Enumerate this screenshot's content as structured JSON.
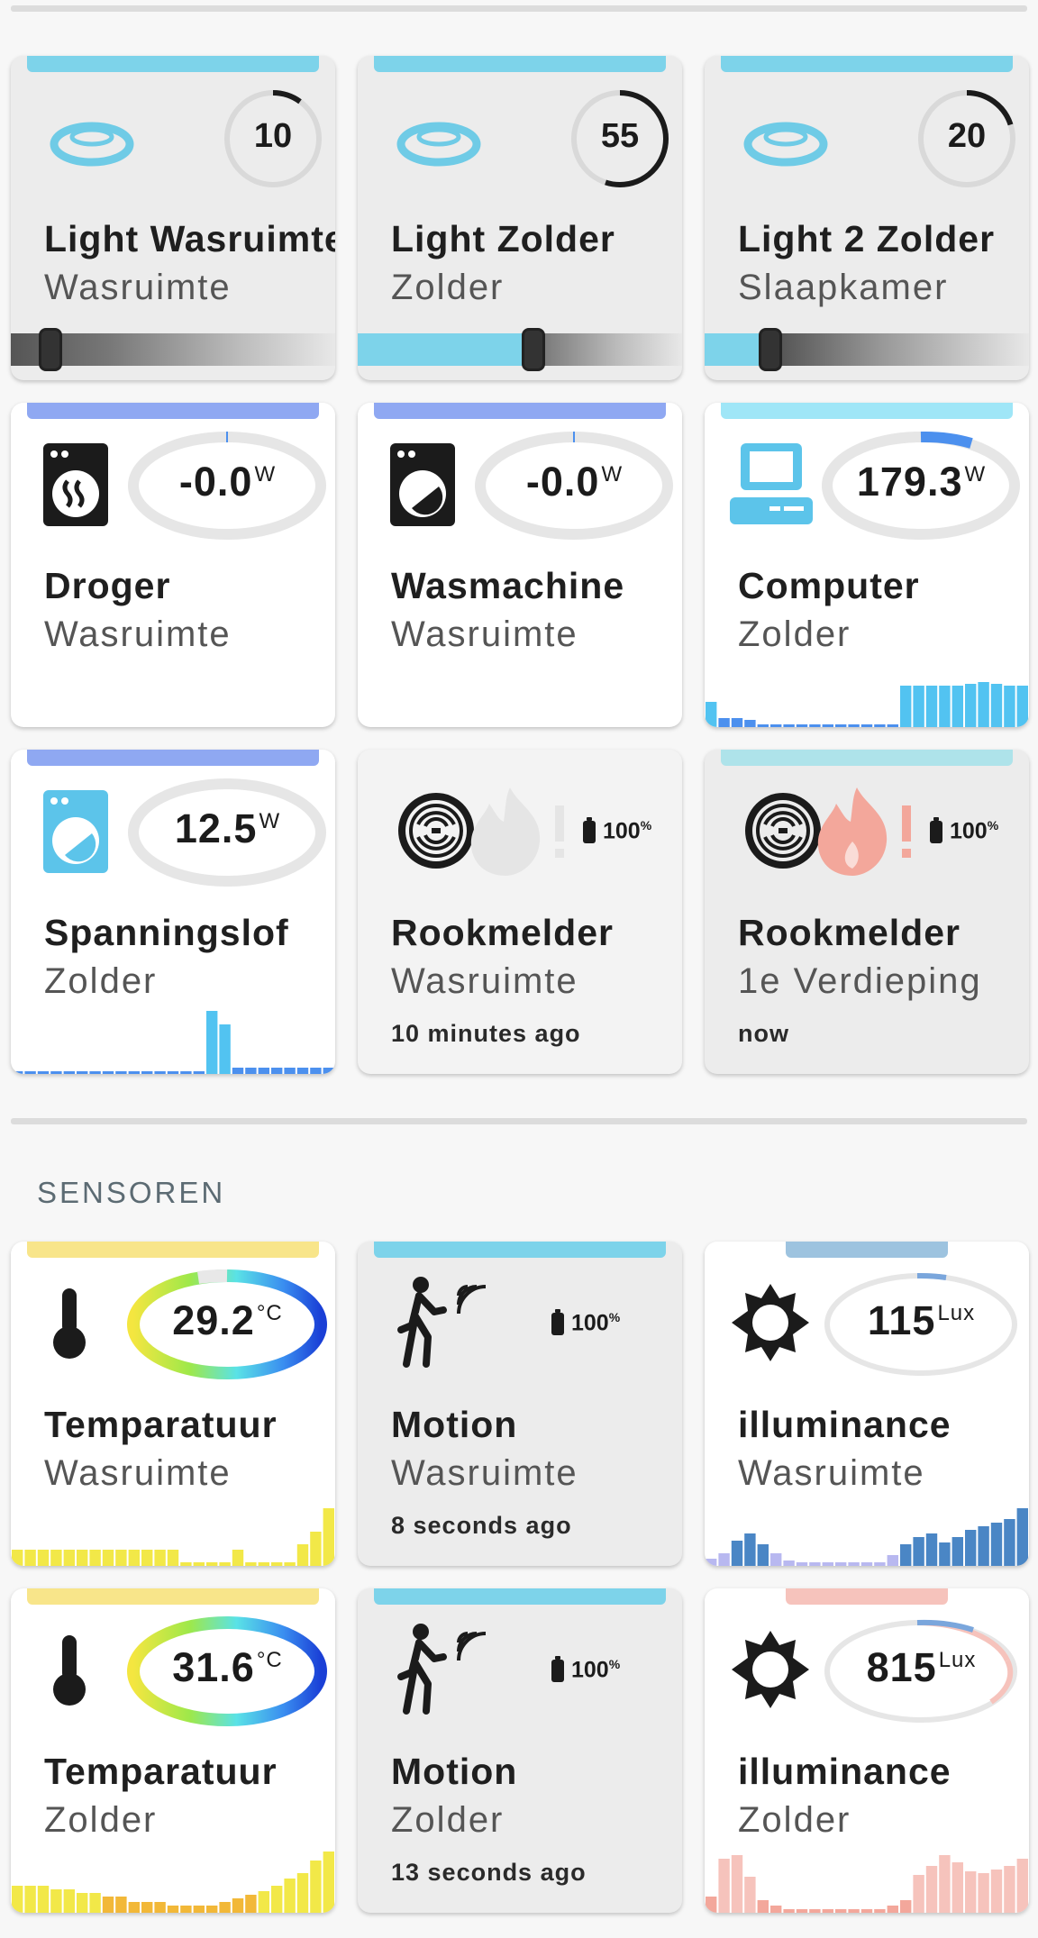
{
  "colors": {
    "light_bar": "#7dd3ea",
    "power_bar": "#8fa8f2",
    "computer_bar": "#9fe6f7",
    "temp_bar": "#f8e58a",
    "lux1_bar": "#9dc3df",
    "lux2_bar": "#f6c3bc",
    "smoke1_bar": "#f3f3f3",
    "smoke2_bar": "#aee3ea",
    "power_spark": "#4c90ee",
    "computer_spark": "#52c3f1",
    "temp_spark": "#f2e848",
    "lux_spark": "#4a86c5"
  },
  "lights": [
    {
      "name": "Light Wasruimte",
      "area": "Wasruimte",
      "brightness": 10,
      "icon": "ceiling-light-icon"
    },
    {
      "name": "Light Zolder",
      "area": "Zolder",
      "brightness": 55,
      "icon": "ceiling-light-icon"
    },
    {
      "name": "Light 2 Zolder",
      "area": "Slaapkamer",
      "brightness": 20,
      "icon": "ceiling-light-icon"
    }
  ],
  "power": [
    {
      "name": "Droger",
      "area": "Wasruimte",
      "value": "-0.0",
      "unit": "W",
      "icon": "tumble-dryer-icon"
    },
    {
      "name": "Wasmachine",
      "area": "Wasruimte",
      "value": "-0.0",
      "unit": "W",
      "icon": "washing-machine-icon"
    },
    {
      "name": "Computer",
      "area": "Zolder",
      "value": "179.3",
      "unit": "W",
      "icon": "desktop-computer-icon"
    },
    {
      "name": "Spanningslof",
      "area": "Zolder",
      "value": "12.5",
      "unit": "W",
      "icon": "washing-machine-icon"
    }
  ],
  "smoke": [
    {
      "name": "Rookmelder",
      "area": "Wasruimte",
      "ago": "10 minutes ago",
      "battery": "100",
      "battery_unit": "%",
      "icon": "smoke-detector-icon",
      "alert": false
    },
    {
      "name": "Rookmelder",
      "area": "1e Verdieping",
      "ago": "now",
      "battery": "100",
      "battery_unit": "%",
      "icon": "smoke-detector-icon",
      "alert": true
    }
  ],
  "sections": {
    "sensors_title": "SENSOREN"
  },
  "sensors": [
    {
      "name": "Temparatuur",
      "area": "Wasruimte",
      "value": "29.2",
      "unit": "°C",
      "icon": "thermometer-icon"
    },
    {
      "name": "Motion",
      "area": "Wasruimte",
      "ago": "8 seconds ago",
      "battery": "100",
      "battery_unit": "%",
      "icon": "motion-sensor-icon"
    },
    {
      "name": "illuminance",
      "area": "Wasruimte",
      "value": "115",
      "unit": "Lux",
      "icon": "sun-icon"
    },
    {
      "name": "Temparatuur",
      "area": "Zolder",
      "value": "31.6",
      "unit": "°C",
      "icon": "thermometer-icon"
    },
    {
      "name": "Motion",
      "area": "Zolder",
      "ago": "13 seconds ago",
      "battery": "100",
      "battery_unit": "%",
      "icon": "motion-sensor-icon"
    },
    {
      "name": "illuminance",
      "area": "Zolder",
      "value": "815",
      "unit": "Lux",
      "icon": "sun-icon"
    }
  ]
}
